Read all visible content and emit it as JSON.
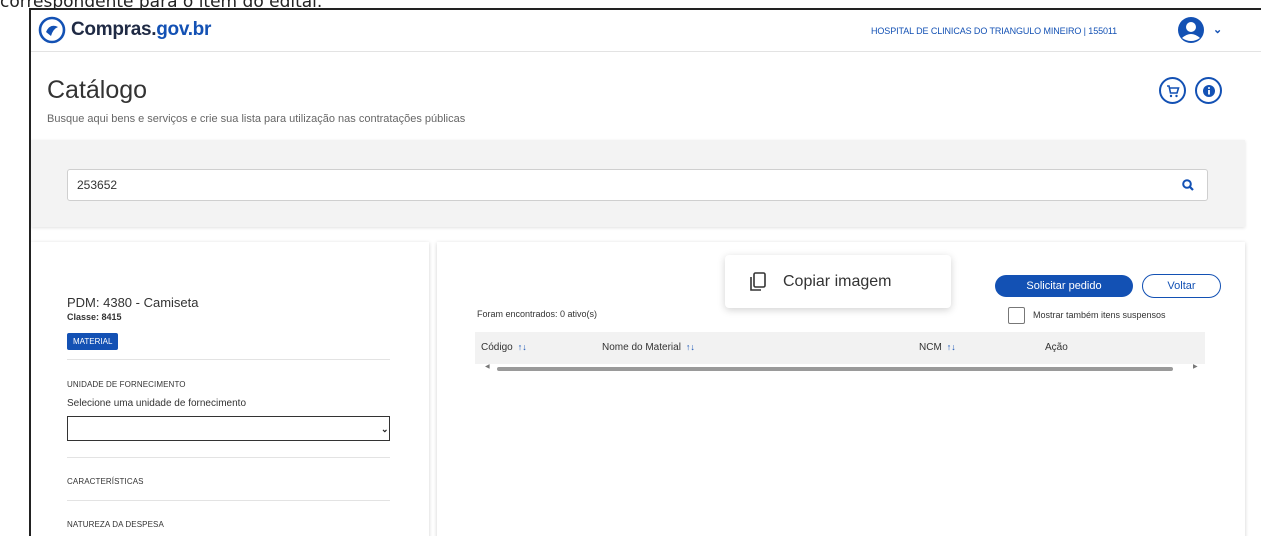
{
  "caption": "correspondente para o item do edital.",
  "header": {
    "logo_text_dark": "Compras.",
    "logo_text_blue": "gov.br",
    "org_label": "HOSPITAL DE CLINICAS DO TRIANGULO MINEIRO | 155011"
  },
  "page": {
    "title": "Catálogo",
    "subtitle": "Busque aqui bens e serviços e crie sua lista para utilização nas contratações públicas"
  },
  "search": {
    "value": "253652"
  },
  "left": {
    "pdm": "PDM: 4380 - Camiseta",
    "classe": "Classe: 8415",
    "badge": "MATERIAL",
    "unidade_label": "UNIDADE DE FORNECIMENTO",
    "select_label": "Selecione uma unidade de fornecimento",
    "select_value": "",
    "caracteristicas": "CARACTERÍSTICAS",
    "natureza": "NATUREZA DA DESPESA"
  },
  "popup": {
    "label": "Copiar imagem"
  },
  "right": {
    "solicitar": "Solicitar pedido",
    "voltar": "Voltar",
    "found": "Foram encontrados: 0 ativo(s)",
    "checkbox_label": "Mostrar também itens suspensos",
    "columns": [
      "Código",
      "Nome do Material",
      "NCM",
      "Ação"
    ],
    "sort_glyph": "↑↓"
  },
  "colors": {
    "brand_blue": "#1351b4"
  }
}
